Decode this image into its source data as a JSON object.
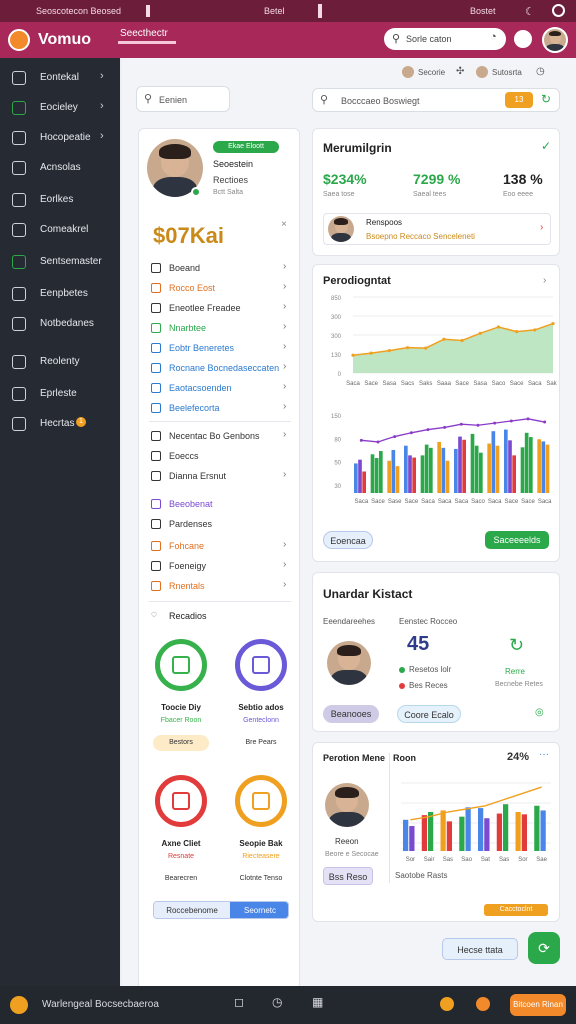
{
  "status": {
    "left": "Seoscotecon Beosed",
    "center": "Betel",
    "right": "Bostet"
  },
  "header": {
    "brand": "Vomuo",
    "subtitle": "Seecthectr",
    "search": {
      "placeholder": "Sorle caton"
    }
  },
  "sidebar": {
    "items": [
      {
        "label": "Eontekal",
        "icon": "person-icon",
        "chevron": true
      },
      {
        "label": "Eocieley",
        "icon": "image-icon",
        "chevron": true
      },
      {
        "label": "Hocopeatie",
        "icon": "window-icon",
        "chevron": true
      },
      {
        "label": "Acnsolas",
        "icon": "calendar-icon",
        "chevron": false
      },
      {
        "label": "Eorlkes",
        "icon": "edit-icon",
        "chevron": false
      },
      {
        "label": "Comeakrel",
        "icon": "circle-icon",
        "chevron": false
      },
      {
        "label": "Sentsemaster",
        "icon": "check-icon",
        "chevron": false
      },
      {
        "label": "Eenpbetes",
        "icon": "tool-icon",
        "chevron": false
      },
      {
        "label": "Notbedanes",
        "icon": "gear-icon",
        "chevron": false
      },
      {
        "label": "Reolenty",
        "icon": "refresh-icon",
        "chevron": false
      },
      {
        "label": "Eprleste",
        "icon": "link-icon",
        "chevron": false
      },
      {
        "label": "Hecrtas",
        "icon": "search-icon",
        "chevron": false,
        "badge": "1"
      }
    ]
  },
  "toprow": {
    "item1": "Secorie",
    "item2": "Sutosrta"
  },
  "main_search": {
    "label": "Eenien"
  },
  "right_search": {
    "label": "Bocccaeo Boswiegt",
    "badge": "13",
    "badge_color": "#f0a020"
  },
  "profile": {
    "tag": "Ekae Eloott",
    "name": "Seoestein",
    "role": "Rectioes",
    "sub": "Bctt Salta",
    "amount": "$07Kai",
    "list": [
      {
        "label": "Boeand",
        "color": "#333"
      },
      {
        "label": "Rocco Eost",
        "color": "#e07020"
      },
      {
        "label": "Eneotlee Freadee",
        "color": "#333"
      },
      {
        "label": "Nnarbtee",
        "color": "#2aa84a"
      },
      {
        "label": "Eobtr Beneretes",
        "color": "#2a7ad0"
      },
      {
        "label": "Rocnane Bocnedaseccaten",
        "color": "#2a7ad0"
      },
      {
        "label": "Eaotacsoenden",
        "color": "#2a7ad0"
      },
      {
        "label": "Beelefecorta",
        "color": "#2a7ad0"
      }
    ],
    "list2": [
      {
        "label": "Necentac Bo Genbons",
        "color": "#333"
      },
      {
        "label": "Eoeccs",
        "color": "#333"
      },
      {
        "label": "Dianna Ersnut",
        "color": "#333"
      }
    ],
    "list3": [
      {
        "label": "Beeobenat",
        "color": "#7a4ad0"
      },
      {
        "label": "Pardenses",
        "color": "#333"
      },
      {
        "label": "Fohcane",
        "color": "#e07020"
      },
      {
        "label": "Foeneigy",
        "color": "#333"
      },
      {
        "label": "Rnentals",
        "color": "#e07020"
      }
    ],
    "section": "Recadios",
    "tiles": [
      {
        "title": "Toocie Diy",
        "sub": "Fbacer Roon",
        "btn": "Bestors",
        "ring": "#36b14c"
      },
      {
        "title": "Sebtio ados",
        "sub": "Genteclonn",
        "btn": "Bre Pears",
        "ring": "#6a5ad8"
      },
      {
        "title": "Axne Cliet",
        "sub": "Resnate",
        "btn": "Bearecren",
        "ring": "#e23b3b"
      },
      {
        "title": "Seopie Bak",
        "sub": "Riecteasere",
        "btn": "Clotnte Tenso",
        "ring": "#f0a020"
      }
    ],
    "footer_left": "Roccebenome",
    "footer_right": "Seornetc"
  },
  "metrics": {
    "title": "Merumilgrin",
    "items": [
      {
        "value": "$234%",
        "label": "Saea tose"
      },
      {
        "value": "7299 %",
        "label": "Saeal tees"
      },
      {
        "value": "138 %",
        "label": "Eoo eeee"
      }
    ],
    "person": {
      "name": "Renspoos",
      "detail": "Bsoepno Reccaco Senceleneti"
    }
  },
  "perf": {
    "title": "Perodiogntat",
    "yt": [
      "850",
      "300",
      "300",
      "130",
      "0"
    ],
    "yb": [
      "150",
      "80",
      "50",
      "30"
    ],
    "btn_left": "Eoencaa",
    "btn_right": "Saceeeelds"
  },
  "chart_data": [
    {
      "type": "area",
      "title": "Perodiogntat",
      "x": [
        "Saca",
        "Sace",
        "Sasa",
        "Sacs",
        "Saks",
        "Saaa",
        "Sace",
        "Sasa",
        "Saco",
        "Sace",
        "Saca",
        "Saks"
      ],
      "values": [
        210,
        235,
        265,
        300,
        295,
        400,
        385,
        470,
        545,
        490,
        510,
        585
      ],
      "ylim": [
        0,
        900
      ]
    },
    {
      "type": "bar",
      "x": [
        "Saca",
        "Sace",
        "Sase",
        "Sace",
        "Saca",
        "Saca",
        "Saca",
        "Saco",
        "Saca",
        "Sace",
        "Sace",
        "Saca"
      ],
      "series": [
        {
          "values": [
            55,
            72,
            60,
            88,
            70,
            95,
            82,
            110,
            92,
            118,
            85,
            100
          ]
        },
        {
          "values": [
            62,
            65,
            80,
            70,
            90,
            84,
            105,
            88,
            115,
            98,
            112,
            96
          ]
        },
        {
          "values": [
            40,
            78,
            50,
            66,
            84,
            60,
            99,
            75,
            88,
            70,
            104,
            90
          ]
        }
      ],
      "line": [
        98,
        95,
        105,
        112,
        118,
        122,
        128,
        126,
        130,
        134,
        138,
        132
      ],
      "ylim": [
        0,
        160
      ]
    },
    {
      "type": "bar",
      "x": [
        "Sor",
        "Sair",
        "Sas",
        "Sao",
        "Sat",
        "Sas",
        "Sor",
        "Sae"
      ],
      "series": [
        {
          "values": [
            40,
            46,
            52,
            44,
            55,
            48,
            50,
            58
          ]
        },
        {
          "values": [
            32,
            50,
            38,
            56,
            42,
            60,
            47,
            52
          ]
        }
      ],
      "line": [
        40,
        44,
        50,
        54,
        58,
        66,
        74,
        82
      ],
      "ylim": [
        0,
        100
      ]
    }
  ],
  "team": {
    "title": "Unardar Kistact",
    "label1": "Eeendareehes",
    "label2": "Eenstec Rocceo",
    "count": "45",
    "stat1": "Resetos lolr",
    "stat2": "Bes Reces",
    "right": "Rerre",
    "right_sub": "Becnebe Retes",
    "btn1": "Beanooes",
    "btn2": "Coore Ecalo"
  },
  "report": {
    "title": "Perotion Mene",
    "sub": "Roon",
    "pct": "24%",
    "person": "Reeon",
    "person_sub": "Beore e Secocae",
    "btn": "Bss Reso",
    "axis": "Saotobe Rasts",
    "orange_btn": "Cacctoclnt",
    "help": "Hecse ttata"
  },
  "bottom": {
    "left": "Warlengeal Bocsecbaeroa",
    "right_btn": "Bitcoen Rinan"
  }
}
